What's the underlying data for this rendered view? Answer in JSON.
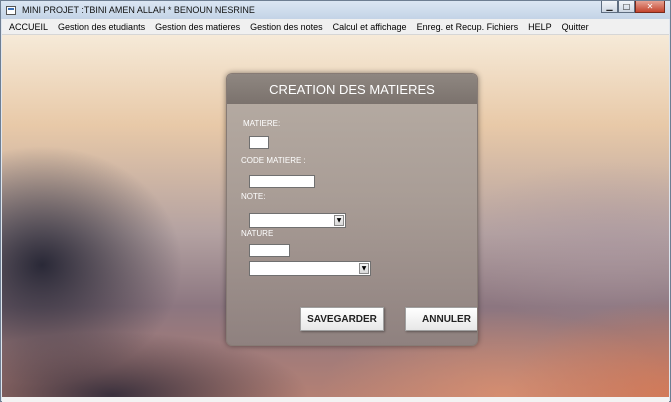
{
  "window": {
    "title": "MINI PROJET :TBINI AMEN ALLAH * BENOUN NESRINE",
    "controls": {
      "minimize": "▁",
      "maximize": "□",
      "close": "✕"
    }
  },
  "menubar": {
    "items": [
      "ACCUEIL",
      "Gestion des etudiants",
      "Gestion des matieres",
      "Gestion des notes",
      "Calcul et affichage",
      "Enreg. et Recup. Fichiers",
      "HELP",
      "Quitter"
    ]
  },
  "form": {
    "title": "CREATION DES MATIERES",
    "labels": {
      "matiere": "MATIERE:",
      "code_matiere": "CODE MATIERE :",
      "note": "NOTE:",
      "nature": "NATURE"
    },
    "values": {
      "matiere": "",
      "code_matiere": "",
      "note": "",
      "nature_text": "",
      "nature_select": ""
    },
    "buttons": {
      "save": "SAVEGARDER",
      "cancel": "ANNULER"
    },
    "icons": {
      "dropdown_arrow": "▼"
    }
  }
}
